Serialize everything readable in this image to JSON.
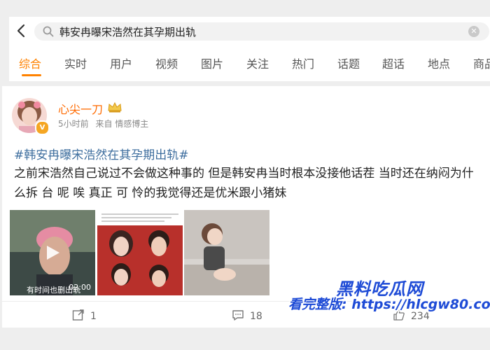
{
  "search": {
    "query": "韩安冉曝宋浩然在其孕期出轨"
  },
  "tabs": [
    {
      "label": "综合"
    },
    {
      "label": "实时"
    },
    {
      "label": "用户"
    },
    {
      "label": "视频"
    },
    {
      "label": "图片"
    },
    {
      "label": "关注"
    },
    {
      "label": "热门"
    },
    {
      "label": "话题"
    },
    {
      "label": "超话"
    },
    {
      "label": "地点"
    },
    {
      "label": "商品"
    }
  ],
  "post": {
    "username": "心尖一刀",
    "time": "5小时前",
    "source": "来自 情感博主",
    "hashtag": "#韩安冉曝宋浩然在其孕期出轨#",
    "text": "之前宋浩然自己说过不会做这种事的 但是韩安冉当时根本没接他话茬 当时还在纳闷为什么拆 台 呢 唉 真正 可 怜的我觉得还是优米跟小猪妹",
    "video": {
      "duration": "02:00",
      "caption": "有时间也删出轨"
    },
    "actions": {
      "repost": "1",
      "comment": "18",
      "like": "234"
    }
  },
  "watermark": {
    "line1": "黑料吃瓜网",
    "line2": "看完整版: https://hlcgw80.com"
  },
  "colors": {
    "accent": "#ff8200",
    "link": "#3e6e9e",
    "username": "#ff6a00"
  }
}
